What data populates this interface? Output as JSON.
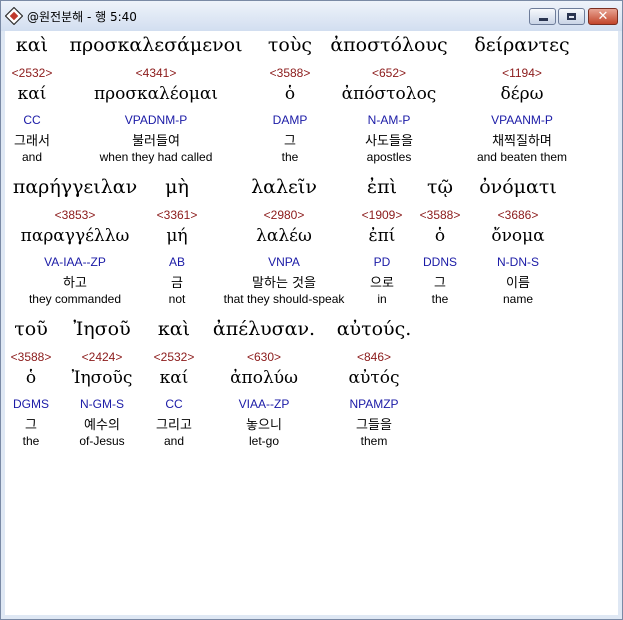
{
  "window": {
    "title": "@원전분해 - 행 5:40",
    "icons": {
      "app": "bible-book-icon",
      "minimize": "minimize-icon",
      "maximize": "maximize-icon",
      "close": "close-icon"
    },
    "close_glyph": "✕",
    "colors": {
      "strong": "#8b1a1a",
      "parse": "#1a1aa6",
      "text": "#000000",
      "titlebar": "#dfe8f4"
    }
  },
  "rows": [
    {
      "words": [
        {
          "greek": "καὶ",
          "strong": "<2532>",
          "lemma": "καί",
          "parse": "CC",
          "korean": "그래서",
          "english": "and"
        },
        {
          "greek": "προσκαλεσάμενοι",
          "strong": "<4341>",
          "lemma": "προσκαλέομαι",
          "parse": "VPADNM-P",
          "korean": "불러들여",
          "english": "when they had called"
        },
        {
          "greek": "τοὺς",
          "strong": "<3588>",
          "lemma": "ὁ",
          "parse": "DAMP",
          "korean": "그",
          "english": "the"
        },
        {
          "greek": "ἀποστόλους",
          "strong": "<652>",
          "lemma": "ἀπόστολος",
          "parse": "N-AM-P",
          "korean": "사도들을",
          "english": "apostles"
        },
        {
          "greek": "δείραντες",
          "strong": "<1194>",
          "lemma": "δέρω",
          "parse": "VPAANM-P",
          "korean": "채찍질하며",
          "english": "and beaten them"
        }
      ]
    },
    {
      "words": [
        {
          "greek": "παρήγγειλαν",
          "strong": "<3853>",
          "lemma": "παραγγέλλω",
          "parse": "VA-IAA--ZP",
          "korean": "하고",
          "english": "they commanded"
        },
        {
          "greek": "μὴ",
          "strong": "<3361>",
          "lemma": "μή",
          "parse": "AB",
          "korean": "금",
          "english": "not"
        },
        {
          "greek": "λαλεῖν",
          "strong": "<2980>",
          "lemma": "λαλέω",
          "parse": "VNPA",
          "korean": "말하는 것을",
          "english": "that they should-speak"
        },
        {
          "greek": "ἐπὶ",
          "strong": "<1909>",
          "lemma": "ἐπί",
          "parse": "PD",
          "korean": "으로",
          "english": "in"
        },
        {
          "greek": "τῷ",
          "strong": "<3588>",
          "lemma": "ὁ",
          "parse": "DDNS",
          "korean": "그",
          "english": "the"
        },
        {
          "greek": "ὀνόματι",
          "strong": "<3686>",
          "lemma": "ὄνομα",
          "parse": "N-DN-S",
          "korean": "이름",
          "english": "name"
        }
      ]
    },
    {
      "words": [
        {
          "greek": "τοῦ",
          "strong": "<3588>",
          "lemma": "ὁ",
          "parse": "DGMS",
          "korean": "그",
          "english": "the"
        },
        {
          "greek": "Ἰησοῦ",
          "strong": "<2424>",
          "lemma": "Ἰησοῦς",
          "parse": "N-GM-S",
          "korean": "예수의",
          "english": "of-Jesus"
        },
        {
          "greek": "καὶ",
          "strong": "<2532>",
          "lemma": "καί",
          "parse": "CC",
          "korean": "그리고",
          "english": "and"
        },
        {
          "greek": "ἀπέλυσαν.",
          "strong": "<630>",
          "lemma": "ἀπολύω",
          "parse": "VIAA--ZP",
          "korean": "놓으니",
          "english": "let-go"
        },
        {
          "greek": "αὐτούς.",
          "strong": "<846>",
          "lemma": "αὐτός",
          "parse": "NPAMZP",
          "korean": "그들을",
          "english": "them"
        }
      ]
    }
  ]
}
